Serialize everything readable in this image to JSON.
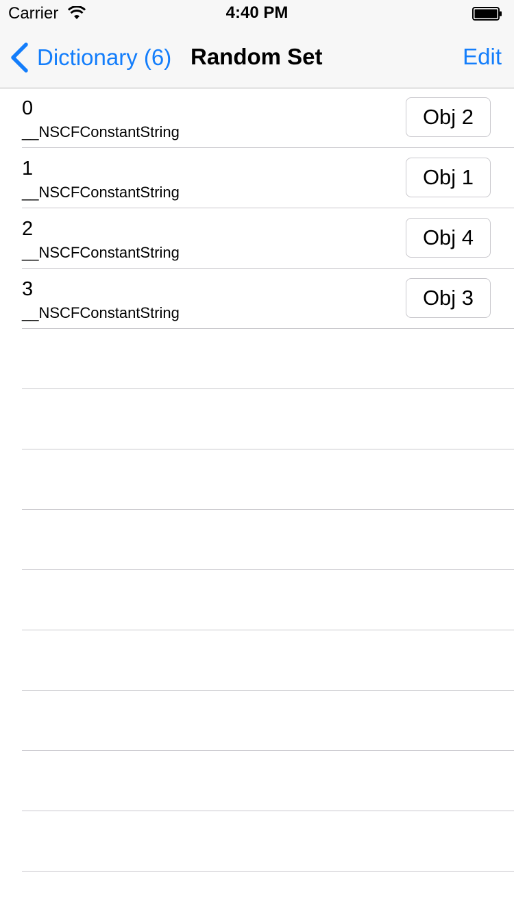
{
  "status_bar": {
    "carrier": "Carrier",
    "time": "4:40 PM",
    "wifi_icon": "wifi-icon",
    "battery_icon": "battery-icon"
  },
  "nav": {
    "back_label": "Dictionary (6)",
    "title": "Random Set",
    "edit_label": "Edit",
    "accent_color": "#147efb"
  },
  "rows": [
    {
      "title": "0",
      "subtitle": "__NSCFConstantString",
      "button": "Obj 2"
    },
    {
      "title": "1",
      "subtitle": "__NSCFConstantString",
      "button": "Obj 1"
    },
    {
      "title": "2",
      "subtitle": "__NSCFConstantString",
      "button": "Obj 4"
    },
    {
      "title": "3",
      "subtitle": "__NSCFConstantString",
      "button": "Obj 3"
    }
  ]
}
